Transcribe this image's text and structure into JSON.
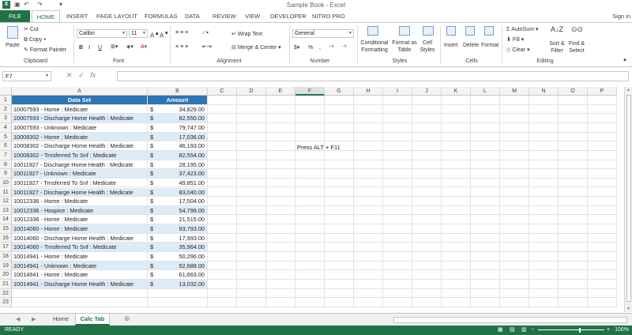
{
  "window": {
    "title": "Sample Book - Excel",
    "signin": "Sign in"
  },
  "tabs": [
    "FILE",
    "HOME",
    "INSERT",
    "PAGE LAYOUT",
    "FORMULAS",
    "DATA",
    "REVIEW",
    "VIEW",
    "DEVELOPER",
    "NITRO PRO"
  ],
  "ribbon": {
    "clipboard": {
      "paste": "Paste",
      "cut": "Cut",
      "copy": "Copy",
      "format_painter": "Format Painter",
      "label": "Clipboard"
    },
    "font": {
      "name": "Calibri",
      "size": "11",
      "label": "Font"
    },
    "alignment": {
      "wrap": "Wrap Text",
      "merge": "Merge & Center",
      "label": "Alignment"
    },
    "number": {
      "format": "General",
      "label": "Number"
    },
    "styles": {
      "cond": "Conditional",
      "cond2": "Formatting",
      "fat": "Format as",
      "fat2": "Table",
      "cell": "Cell",
      "cell2": "Styles",
      "label": "Styles"
    },
    "cells": {
      "insert": "Insert",
      "delete": "Delete",
      "format": "Format",
      "label": "Cells"
    },
    "editing": {
      "autosum": "AutoSum",
      "fill": "Fill",
      "clear": "Clear",
      "sort": "Sort &",
      "sort2": "Filter",
      "find": "Find &",
      "find2": "Select",
      "label": "Editing"
    }
  },
  "formula_bar": {
    "name_box": "F7",
    "fx": "fx",
    "content": ""
  },
  "columns": [
    "A",
    "B",
    "C",
    "D",
    "E",
    "F",
    "G",
    "H",
    "I",
    "J",
    "K",
    "L",
    "M",
    "N",
    "O",
    "P"
  ],
  "selected_column": "F",
  "sheet": {
    "header": {
      "a": "Data Set",
      "b": "Amount"
    },
    "rows": [
      {
        "a": "10007593 - Home : Medicate",
        "b": "34,829.00"
      },
      {
        "a": "10007593 - Discharge Home Health : Medicate",
        "b": "82,550.00"
      },
      {
        "a": "10007593 - Unknown : Medicate",
        "b": "79,747.00"
      },
      {
        "a": "10008302 - Home : Medicate",
        "b": "17,036.00"
      },
      {
        "a": "10008302 - Discharge Home Health : Medicate",
        "b": "46,193.00"
      },
      {
        "a": "10008302 - Trnsferred To Snf : Medicate",
        "b": "82,554.00"
      },
      {
        "a": "10011927 - Discharge Home Health : Medicate",
        "b": "28,195.00"
      },
      {
        "a": "10011927 - Unknown : Medicate",
        "b": "37,423.00"
      },
      {
        "a": "10011927 - Trnsferred To Snf : Medicate",
        "b": "49,851.00"
      },
      {
        "a": "10011927 - Discharge Home Health : Medicate",
        "b": "83,040.00"
      },
      {
        "a": "10012336 - Home : Medicate",
        "b": "17,504.00"
      },
      {
        "a": "10012336 - Hospice : Medicate",
        "b": "54,798.00"
      },
      {
        "a": "10012336 - Home : Medicate",
        "b": "21,515.00"
      },
      {
        "a": "10014060 - Home : Medicate",
        "b": "93,793.00"
      },
      {
        "a": "10014060 - Discharge Home Health : Medicate",
        "b": "17,993.00"
      },
      {
        "a": "10014060 - Trnsferred To Snf : Medicate",
        "b": "35,964.00"
      },
      {
        "a": "10014941 - Home : Medicate",
        "b": "50,296.00"
      },
      {
        "a": "10014941 - Unknown : Medicate",
        "b": "52,688.00"
      },
      {
        "a": "10014941 - Home : Medicate",
        "b": "61,663.00"
      },
      {
        "a": "10014941 - Discharge Home Health : Medicate",
        "b": "13,032.00"
      }
    ],
    "currency": "$",
    "note": "Press ALT + F11"
  },
  "sheet_tabs": [
    "Home",
    "Calc Tab"
  ],
  "active_sheet": "Calc Tab",
  "status": {
    "ready": "READY",
    "zoom": "100%"
  }
}
